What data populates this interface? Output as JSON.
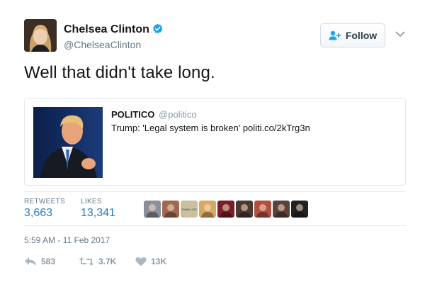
{
  "author": {
    "name": "Chelsea Clinton",
    "handle": "@ChelseaClinton",
    "verified": true
  },
  "follow_button": {
    "label": "Follow"
  },
  "tweet": {
    "text": "Well that didn't take long."
  },
  "quoted_card": {
    "name": "POLITICO",
    "handle": "@politico",
    "text": "Trump: 'Legal system is broken' politi.co/2kTrg3n"
  },
  "stats": {
    "retweets_label": "RETWEETS",
    "retweets_value": "3,663",
    "likes_label": "LIKES",
    "likes_value": "13,341"
  },
  "liker_avatars": [
    {
      "color": "#8a8f99",
      "icon": "avatar-1"
    },
    {
      "color": "#a06850",
      "icon": "avatar-2"
    },
    {
      "color": "#c8c0a0",
      "icon": "avatar-3",
      "text": "THINK LIFE"
    },
    {
      "color": "#d8a860",
      "icon": "avatar-4"
    },
    {
      "color": "#7a1f2a",
      "icon": "avatar-5"
    },
    {
      "color": "#4a3a30",
      "icon": "avatar-6"
    },
    {
      "color": "#b05040",
      "icon": "avatar-7"
    },
    {
      "color": "#5a4438",
      "icon": "avatar-8"
    },
    {
      "color": "#222222",
      "icon": "avatar-9"
    }
  ],
  "timestamp": "5:59 AM - 11 Feb 2017",
  "actions": {
    "reply_count": "583",
    "retweet_count": "3.7K",
    "like_count": "13K"
  },
  "colors": {
    "link_blue": "#2b7bb9",
    "verified_blue": "#1da1f2",
    "muted": "#657786",
    "action_gray": "#aab8c2"
  }
}
